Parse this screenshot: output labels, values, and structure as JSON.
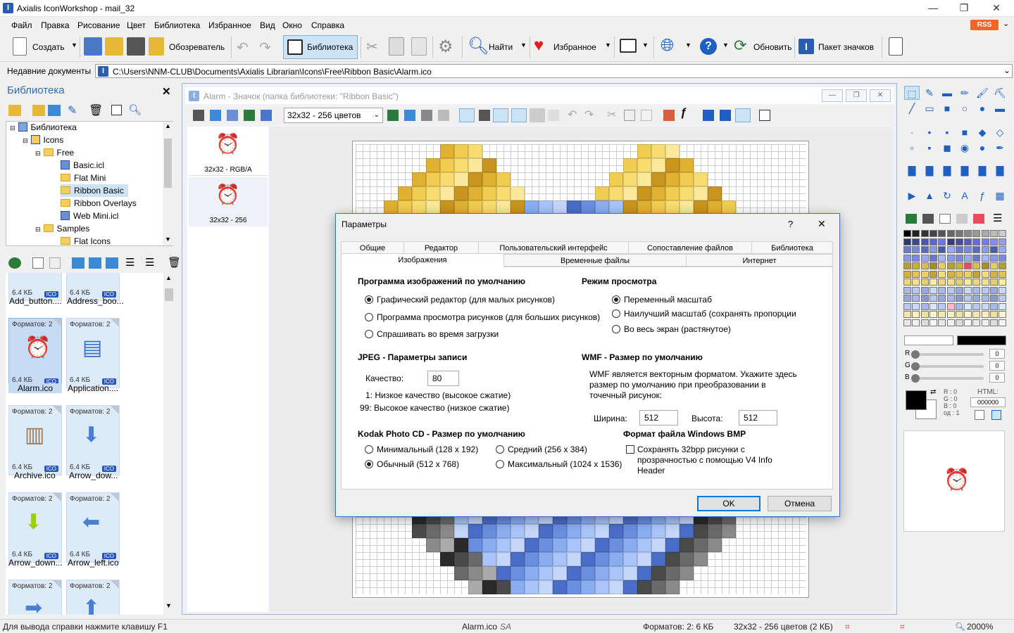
{
  "window": {
    "title": "Axialis IconWorkshop - mail_32",
    "minimize": "—",
    "restore": "❐",
    "close": "✕"
  },
  "menu": [
    "Файл",
    "Правка",
    "Рисование",
    "Цвет",
    "Библиотека",
    "Избранное",
    "Вид",
    "Окно",
    "Справка"
  ],
  "rss": "RSS",
  "toolbar": {
    "create": "Создать",
    "explorer": "Обозреватель",
    "library": "Библиотека",
    "find": "Найти",
    "favorites": "Избранное",
    "update": "Обновить",
    "icon_pack": "Пакет значков"
  },
  "recent": {
    "label": "Недавние документы",
    "path": "C:\\Users\\NNM-CLUB\\Documents\\Axialis Librarian\\Icons\\Free\\Ribbon Basic\\Alarm.ico"
  },
  "library": {
    "title": "Библиотека",
    "close": "✕",
    "tree": [
      {
        "label": "Библиотека",
        "depth": 0,
        "type": "root"
      },
      {
        "label": "Icons",
        "depth": 1,
        "type": "root"
      },
      {
        "label": "Free",
        "depth": 2,
        "type": "folder"
      },
      {
        "label": "Basic.icl",
        "depth": 3,
        "type": "file"
      },
      {
        "label": "Flat Mini",
        "depth": 3,
        "type": "folder"
      },
      {
        "label": "Ribbon Basic",
        "depth": 3,
        "type": "folder",
        "selected": true
      },
      {
        "label": "Ribbon Overlays",
        "depth": 3,
        "type": "folder"
      },
      {
        "label": "Web Mini.icl",
        "depth": 3,
        "type": "file"
      },
      {
        "label": "Samples",
        "depth": 2,
        "type": "folder"
      },
      {
        "label": "Flat Icons",
        "depth": 3,
        "type": "folder"
      }
    ],
    "tiles": [
      {
        "format": "",
        "size": "6.4 КБ",
        "badge": "ICO",
        "name": "Add_button....",
        "glyph": ""
      },
      {
        "format": "",
        "size": "6.4 КБ",
        "badge": "ICO",
        "name": "Address_boo...",
        "glyph": ""
      },
      {
        "format": "Форматов: 2",
        "size": "6.4 КБ",
        "badge": "ICO",
        "name": "Alarm.ico",
        "glyph": "⏰",
        "selected": true
      },
      {
        "format": "Форматов: 2",
        "size": "6.4 КБ",
        "badge": "ICO",
        "name": "Application....",
        "glyph": "▤"
      },
      {
        "format": "Форматов: 2",
        "size": "6.4 КБ",
        "badge": "ICO",
        "name": "Archive.ico",
        "glyph": "▥"
      },
      {
        "format": "Форматов: 2",
        "size": "6.4 КБ",
        "badge": "ICO",
        "name": "Arrow_dow...",
        "glyph": "⬇"
      },
      {
        "format": "Форматов: 2",
        "size": "6.4 КБ",
        "badge": "ICO",
        "name": "Arrow_down...",
        "glyph": "⬇"
      },
      {
        "format": "Форматов: 2",
        "size": "6.4 КБ",
        "badge": "ICO",
        "name": "Arrow_left.ico",
        "glyph": "⬅"
      },
      {
        "format": "Форматов: 2",
        "size": "",
        "badge": "",
        "name": "",
        "glyph": "➡"
      },
      {
        "format": "Форматов: 2",
        "size": "",
        "badge": "",
        "name": "",
        "glyph": "⬆"
      }
    ]
  },
  "doc": {
    "title": "Alarm - Значок (папка библиотеки: \"Ribbon Basic\")",
    "format_select": "32x32 - 256 цветов",
    "formats": [
      {
        "label": "32x32 - RGB/A"
      },
      {
        "label": "32x32 - 256"
      }
    ]
  },
  "dialog": {
    "title": "Параметры",
    "help": "?",
    "close": "✕",
    "tabs_row1": [
      "Общие",
      "Редактор",
      "Пользовательский интерфейс",
      "Сопоставление файлов",
      "Библиотека"
    ],
    "tabs_row2": [
      "Изображения",
      "Временные файлы",
      "Интернет"
    ],
    "default_program": {
      "heading": "Программа изображений по умолчанию",
      "options": [
        "Графический редактор (для малых рисунков)",
        "Программа просмотра рисунков (для больших рисунков)",
        "Спрашивать во время загрузки"
      ],
      "selected": 0
    },
    "view_mode": {
      "heading": "Режим просмотра",
      "options": [
        "Переменный масштаб",
        "Наилучший масштаб (сохранять пропорции",
        "Во весь экран (растянутое)"
      ],
      "selected": 0
    },
    "jpeg": {
      "heading": "JPEG - Параметры записи",
      "quality_label": "Качество:",
      "quality_value": "80",
      "hint1": "1: Низкое качество (высокое сжатие)",
      "hint2": "99: Высокое качество (низкое сжатие)"
    },
    "wmf": {
      "heading": "WMF - Размер по умолчанию",
      "desc": "WMF является векторным форматом. Укажите здесь размер по умолчанию при преобразовании в точечный рисунок:",
      "width_label": "Ширина:",
      "width_value": "512",
      "height_label": "Высота:",
      "height_value": "512"
    },
    "kodak": {
      "heading": "Kodak Photo CD - Размер по умолчанию",
      "options": [
        "Минимальный (128 x 192)",
        "Средний (256 x 384)",
        "Обычный (512 x 768)",
        "Максимальный (1024 x 1536)"
      ],
      "selected": 2
    },
    "bmp": {
      "heading": "Формат файла Windows BMP",
      "checkbox_label": "Сохранять 32bpp рисунки с прозрачностью с помощью V4 Info Header",
      "checked": false
    },
    "ok": "OK",
    "cancel": "Отмена"
  },
  "color_panel": {
    "r_label": "R",
    "g_label": "G",
    "b_label": "B",
    "r": "0",
    "g": "0",
    "b": "0",
    "html_label": "HTML:",
    "html_value": "000000",
    "rgb_readout": "R : 0\nG : 0\nB : 0\nод : 1"
  },
  "status": {
    "help": "Для вывода справки нажмите клавишу F1",
    "file": "Alarm.ico",
    "formats": "Форматов: 2: 6 КБ",
    "info": "32x32 - 256 цветов (2 КБ)",
    "zoom": "2000%"
  },
  "colors": {
    "accent": "#0078d7",
    "lib_title": "#2b6cb0",
    "dialog_border": "#3a6fc4"
  }
}
